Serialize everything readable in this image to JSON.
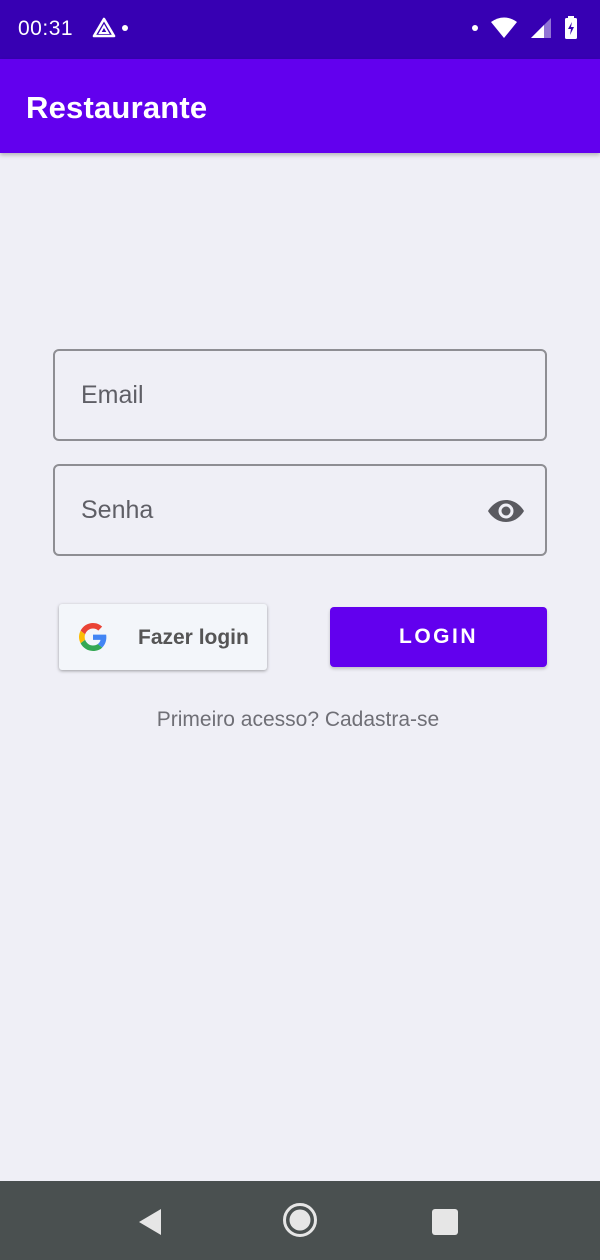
{
  "status_bar": {
    "time": "00:31",
    "icons": [
      "drive-icon",
      "notification-dot-icon",
      "wifi-icon",
      "signal-icon",
      "battery-charging-icon"
    ]
  },
  "app_bar": {
    "title": "Restaurante"
  },
  "login_form": {
    "email_placeholder": "Email",
    "email_value": "",
    "password_placeholder": "Senha",
    "password_value": "",
    "google_button_label": "Fazer login",
    "login_button_label": "LOGIN",
    "signup_link": "Primeiro acesso? Cadastra-se"
  },
  "navigation_bar": {
    "icons": [
      "back-icon",
      "home-icon",
      "recents-icon"
    ]
  },
  "colors": {
    "status_bar": "#3700B3",
    "primary": "#6200EE",
    "background": "#EFEFF6",
    "nav_bar": "#4A5050"
  }
}
